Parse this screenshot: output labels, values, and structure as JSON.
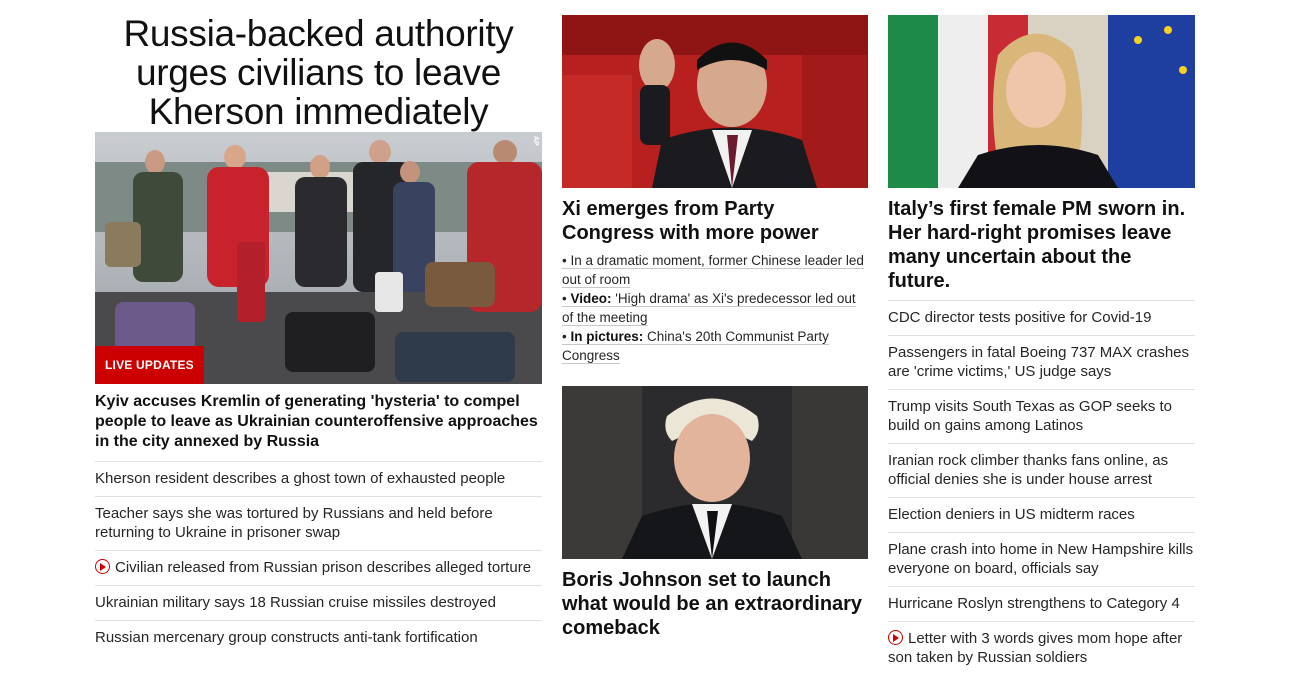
{
  "left": {
    "lead_headline": "Russia-backed authority urges civilians to leave Kherson immediately",
    "badge": "LIVE UPDATES",
    "photo_credit": "AP",
    "story_headline": "Kyiv accuses Kremlin of generating 'hysteria' to compel people to leave as Ukrainian counteroffensive approaches in the city annexed by Russia",
    "links": [
      {
        "text": "Kherson resident describes a ghost town of exhausted people",
        "video": false
      },
      {
        "text": "Teacher says she was tortured by Russians and held before returning to Ukraine in prisoner swap",
        "video": false
      },
      {
        "text": "Civilian released from Russian prison describes alleged torture",
        "video": true
      },
      {
        "text": "Ukrainian military says 18 Russian cruise missiles destroyed",
        "video": false
      },
      {
        "text": "Russian mercenary group constructs anti-tank fortification",
        "video": false
      }
    ]
  },
  "middle": {
    "story1": {
      "headline": "Xi emerges from Party Congress with more power",
      "bullets": [
        {
          "label": "",
          "text": "In a dramatic moment, former Chinese leader led out of room"
        },
        {
          "label": "Video:",
          "text": "'High drama' as Xi's predecessor led out of the meeting"
        },
        {
          "label": "In pictures:",
          "text": "China's 20th Communist Party Congress"
        }
      ]
    },
    "story2": {
      "headline": "Boris Johnson set to launch what would be an extraordinary comeback"
    }
  },
  "right": {
    "story_headline": "Italy’s first female PM sworn in. Her hard-right promises leave many uncertain about the future.",
    "links": [
      {
        "text": "CDC director tests positive for Covid-19",
        "video": false
      },
      {
        "text": "Passengers in fatal Boeing 737 MAX crashes are 'crime victims,' US judge says",
        "video": false
      },
      {
        "text": "Trump visits South Texas as GOP seeks to build on gains among Latinos",
        "video": false
      },
      {
        "text": "Iranian rock climber thanks fans online, as official denies she is under house arrest",
        "video": false
      },
      {
        "text": "Election deniers in US midterm races",
        "video": false
      },
      {
        "text": "Plane crash into home in New Hampshire kills everyone on board, officials say",
        "video": false
      },
      {
        "text": "Hurricane Roslyn strengthens to Category 4",
        "video": false
      },
      {
        "text": "Letter with 3 words gives mom hope after son taken by Russian soldiers",
        "video": true
      }
    ]
  },
  "colors": {
    "accent_red": "#cc0000",
    "text": "#0c0c0c",
    "divider": "#e0e0e0"
  }
}
